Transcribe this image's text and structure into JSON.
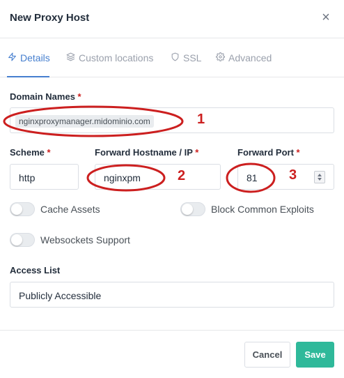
{
  "modal": {
    "title": "New Proxy Host",
    "close_glyph": "×"
  },
  "tabs": [
    {
      "label": "Details",
      "icon": "bolt-icon",
      "active": true
    },
    {
      "label": "Custom locations",
      "icon": "layers-icon",
      "active": false
    },
    {
      "label": "SSL",
      "icon": "shield-icon",
      "active": false
    },
    {
      "label": "Advanced",
      "icon": "gear-icon",
      "active": false
    }
  ],
  "form": {
    "domain_names": {
      "label": "Domain Names",
      "required_mark": "*",
      "value": "nginxproxymanager.midominio.com"
    },
    "scheme": {
      "label": "Scheme",
      "required_mark": "*",
      "value": "http"
    },
    "forward_host": {
      "label": "Forward Hostname / IP",
      "required_mark": "*",
      "value": "nginxpm"
    },
    "forward_port": {
      "label": "Forward Port",
      "required_mark": "*",
      "value": "81"
    },
    "toggles": [
      {
        "label": "Cache Assets",
        "on": false
      },
      {
        "label": "Block Common Exploits",
        "on": false
      },
      {
        "label": "Websockets Support",
        "on": false
      }
    ],
    "access_list": {
      "label": "Access List",
      "value": "Publicly Accessible"
    }
  },
  "footer": {
    "cancel_label": "Cancel",
    "save_label": "Save"
  },
  "annotations": {
    "numbers": [
      "1",
      "2",
      "3"
    ],
    "color": "#cc1f1f"
  },
  "colors": {
    "accent": "#467fcf",
    "save_button": "#2fb99a",
    "required": "#cd201f"
  }
}
